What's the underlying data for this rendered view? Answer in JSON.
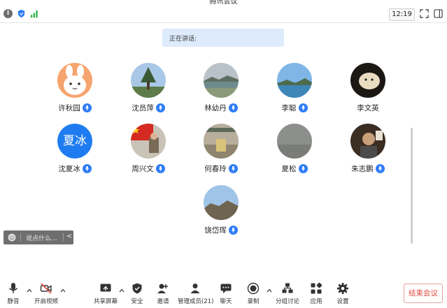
{
  "app_title": "腾讯会议",
  "top_bar": {
    "clock": "12:19"
  },
  "speaking": {
    "label": "正在讲话:"
  },
  "participants": [
    {
      "name": "许秋园",
      "avatar": "cartoon-bunny",
      "mic": true
    },
    {
      "name": "沈员萍",
      "avatar": "tree-photo",
      "mic": true
    },
    {
      "name": "林幼丹",
      "avatar": "coast-photo",
      "mic": true
    },
    {
      "name": "李聪",
      "avatar": "sea-photo",
      "mic": true
    },
    {
      "name": "李文英",
      "avatar": "dog-photo",
      "mic": false
    },
    {
      "name": "沈夏冰",
      "avatar": "initials",
      "initials": "夏冰",
      "mic": true
    },
    {
      "name": "周兴文",
      "avatar": "flag-photo",
      "mic": true
    },
    {
      "name": "何春玲",
      "avatar": "room-photo",
      "mic": true
    },
    {
      "name": "夏松",
      "avatar": "gray-photo",
      "mic": true
    },
    {
      "name": "朱志鹏",
      "avatar": "person-photo",
      "mic": true
    },
    {
      "name": "饶岱珲",
      "avatar": "hill-photo",
      "mic": true
    }
  ],
  "chat": {
    "placeholder": "说点什么...",
    "collapse": "<"
  },
  "toolbar": {
    "mute": "静音",
    "video": "开启视频",
    "share": "共享屏幕",
    "security": "安全",
    "invite": "邀请",
    "members": "管理成员(21)",
    "chat": "聊天",
    "record": "录制",
    "breakout": "分组讨论",
    "apps": "应用",
    "settings": "设置",
    "end": "结束会议"
  },
  "colors": {
    "accent": "#2f7cf6",
    "banner": "#ddebfc",
    "end_text": "#e2483d",
    "signal": "#2bb24c"
  }
}
